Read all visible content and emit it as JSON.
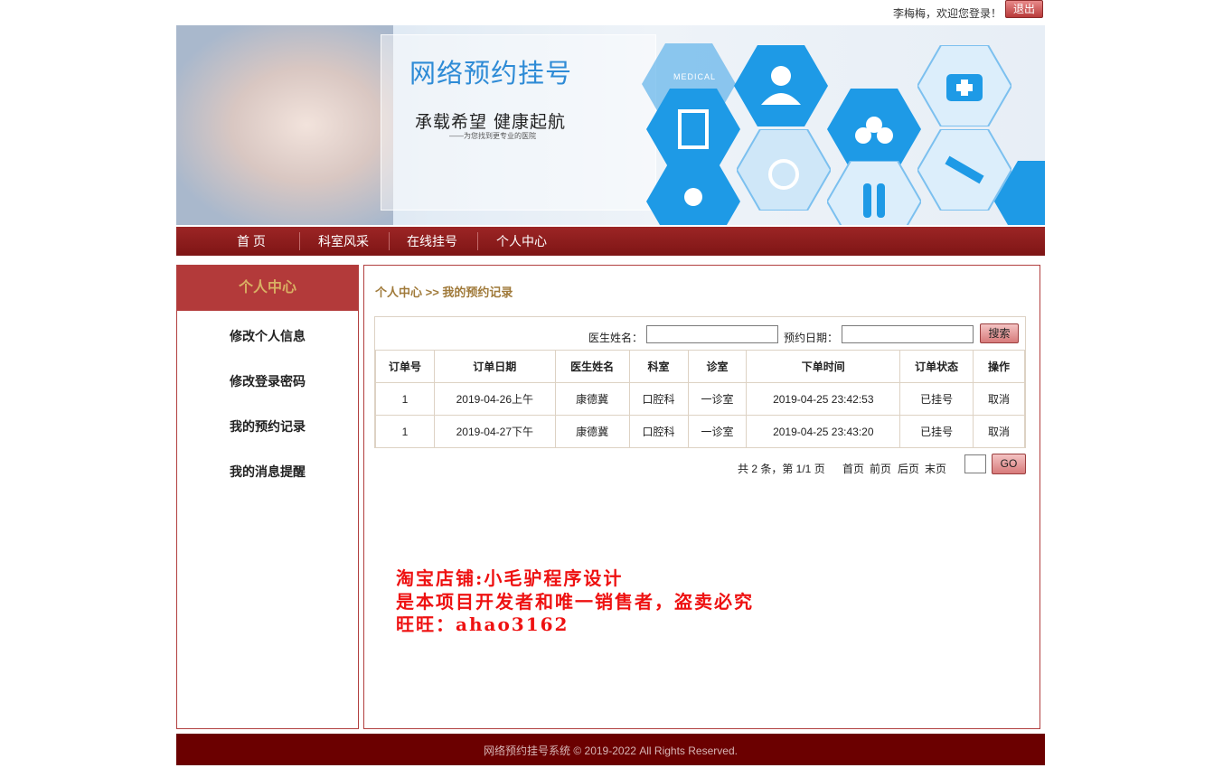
{
  "topbar": {
    "welcome": "李梅梅，欢迎您登录！",
    "logout": "退出"
  },
  "banner": {
    "title": "网络预约挂号",
    "slogan": "承载希望  健康起航",
    "subtitle": "——为您找到更专业的医院",
    "medical": "MEDICAL"
  },
  "nav": {
    "items": [
      "首 页",
      "科室风采",
      "在线挂号",
      "个人中心"
    ]
  },
  "sidebar": {
    "title": "个人中心",
    "items": [
      "修改个人信息",
      "修改登录密码",
      "我的预约记录",
      "我的消息提醒"
    ]
  },
  "main": {
    "breadcrumb": "个人中心 >> 我的预约记录",
    "search": {
      "doctor_label": "医生姓名：",
      "doctor_value": "",
      "date_label": "预约日期：",
      "date_value": "",
      "button": "搜索"
    },
    "table": {
      "headers": [
        "订单号",
        "订单日期",
        "医生姓名",
        "科室",
        "诊室",
        "下单时间",
        "订单状态",
        "操作"
      ],
      "rows": [
        [
          "1",
          "2019-04-26上午",
          "康德冀",
          "口腔科",
          "一诊室",
          "2019-04-25 23:42:53",
          "已挂号",
          "取消"
        ],
        [
          "1",
          "2019-04-27下午",
          "康德冀",
          "口腔科",
          "一诊室",
          "2019-04-25 23:43:20",
          "已挂号",
          "取消"
        ]
      ]
    },
    "pager": {
      "summary": "共 2 条，第 1/1 页",
      "first": "首页",
      "prev": "前页",
      "next": "后页",
      "last": "末页",
      "page_value": "",
      "go": "GO"
    }
  },
  "watermark": {
    "line1": "淘宝店铺:小毛驴程序设计",
    "line2": "是本项目开发者和唯一销售者，盗卖必究",
    "line3": "旺旺：ahao3162"
  },
  "footer": {
    "text": "网络预约挂号系统  © 2019-2022 All Rights Reserved."
  },
  "colors": {
    "brand": "#7e1515",
    "sidebar_header": "#b33a3a",
    "accent_text": "#a07a3a",
    "footer": "#6b0000",
    "watermark": "#ee1111"
  }
}
